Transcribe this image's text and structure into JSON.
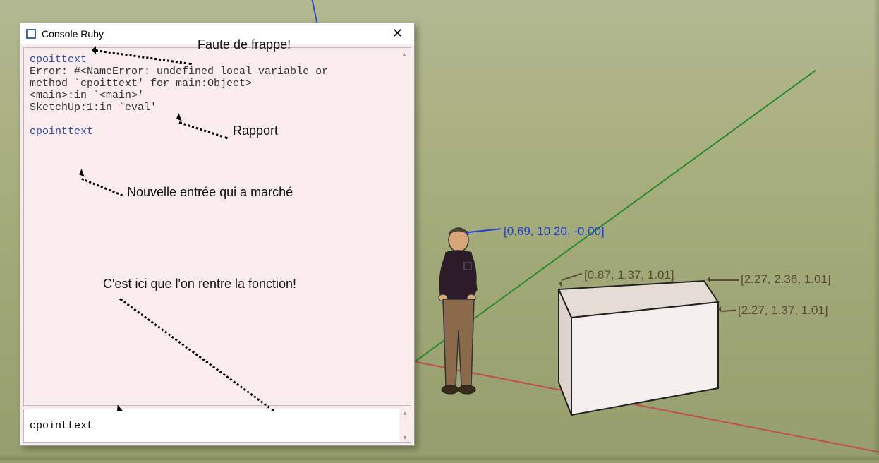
{
  "console": {
    "title": "Console Ruby",
    "output_line1": "cpoittext",
    "output_error1": "Error: #<NameError: undefined local variable or",
    "output_error2": "method `cpoittext' for main:Object>",
    "output_error3": "<main>:in `<main>'",
    "output_error4": "SketchUp:1:in `eval'",
    "output_line2": "cpointtext",
    "input_value": "cpointtext"
  },
  "annotations": {
    "typo": "Faute de frappe!",
    "report": "Rapport",
    "worked": "Nouvelle entrée qui a marché",
    "enter_here": "C'est ici que l'on rentre la fonction!"
  },
  "labels": {
    "head": "[0.69, 10.20, -0.00]",
    "top_left": "[0.87, 1.37, 1.01]",
    "top_right": "[2.27, 2.36, 1.01]",
    "mid_right": "[2.27, 1.37, 1.01]"
  }
}
